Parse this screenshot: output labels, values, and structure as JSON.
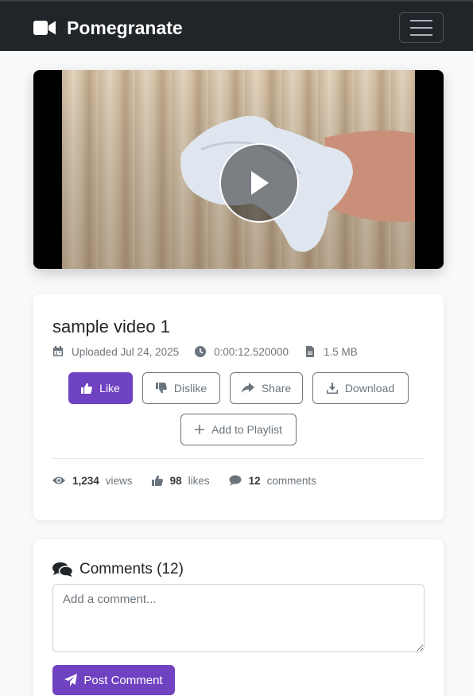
{
  "navbar": {
    "brand": "Pomegranate",
    "brand_icon": "video-camera-icon",
    "menu_icon": "hamburger-menu-icon"
  },
  "video": {
    "play_icon": "play-icon"
  },
  "details": {
    "title": "sample video 1",
    "uploaded": "Uploaded Jul 24, 2025",
    "duration": "0:00:12.520000",
    "size": "1.5 MB"
  },
  "actions": {
    "like": "Like",
    "dislike": "Dislike",
    "share": "Share",
    "download": "Download",
    "add_to_playlist": "Add to Playlist"
  },
  "stats": {
    "views_count": "1,234",
    "views_label": "views",
    "likes_count": "98",
    "likes_label": "likes",
    "comments_count": "12",
    "comments_label": "comments"
  },
  "comments": {
    "heading": "Comments (12)",
    "placeholder": "Add a comment...",
    "post_label": "Post Comment"
  },
  "colors": {
    "navbar": "#212529",
    "accent": "#6f42c1",
    "muted": "#6c757d"
  }
}
